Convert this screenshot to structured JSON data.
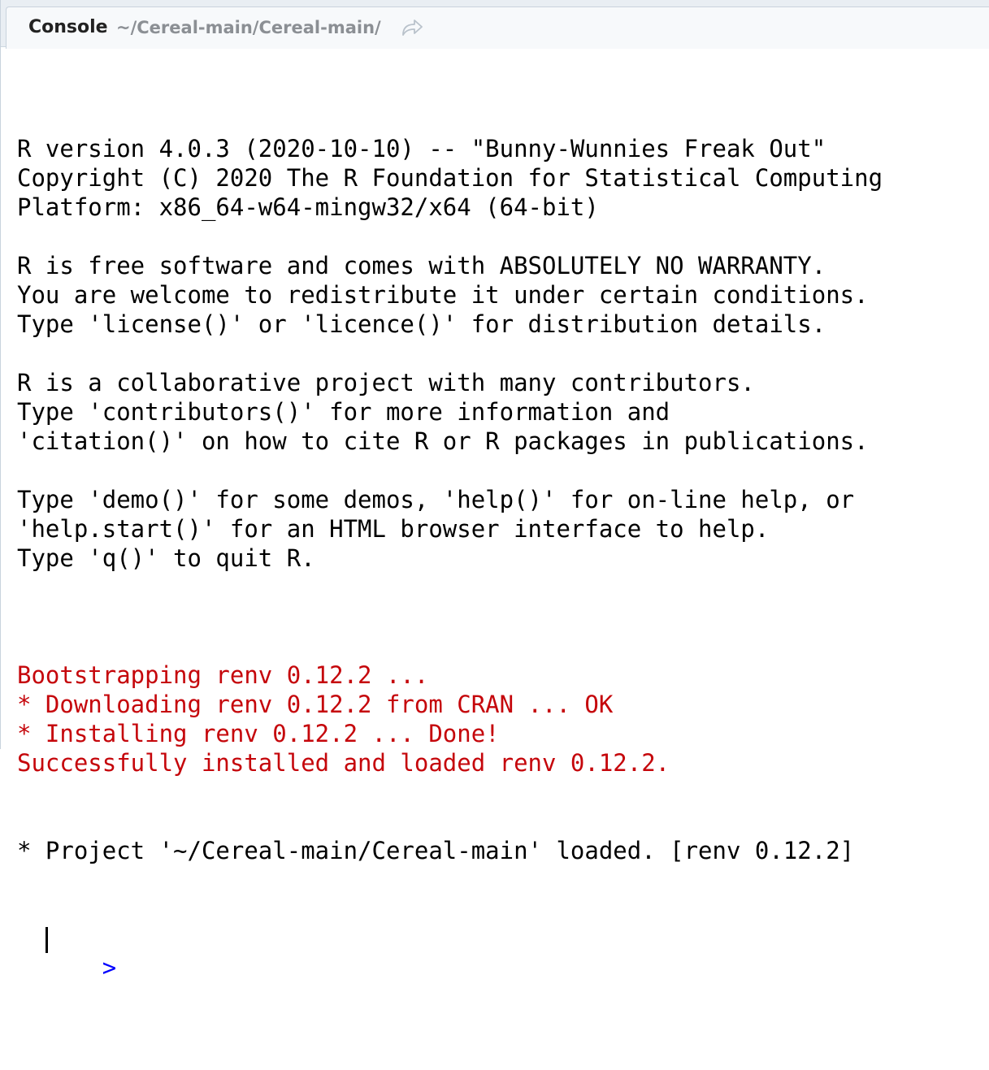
{
  "tab": {
    "title": "Console",
    "path": "~/Cereal-main/Cereal-main/",
    "goto_icon": "goto-directory-arrow-icon"
  },
  "console": {
    "startup_lines": [
      "R version 4.0.3 (2020-10-10) -- \"Bunny-Wunnies Freak Out\"",
      "Copyright (C) 2020 The R Foundation for Statistical Computing",
      "Platform: x86_64-w64-mingw32/x64 (64-bit)",
      "",
      "R is free software and comes with ABSOLUTELY NO WARRANTY.",
      "You are welcome to redistribute it under certain conditions.",
      "Type 'license()' or 'licence()' for distribution details.",
      "",
      "R is a collaborative project with many contributors.",
      "Type 'contributors()' for more information and",
      "'citation()' on how to cite R or R packages in publications.",
      "",
      "Type 'demo()' for some demos, 'help()' for on-line help, or",
      "'help.start()' for an HTML browser interface to help.",
      "Type 'q()' to quit R.",
      ""
    ],
    "message_lines": [
      "Bootstrapping renv 0.12.2 ...",
      "* Downloading renv 0.12.2 from CRAN ... OK",
      "* Installing renv 0.12.2 ... Done!",
      "Successfully installed and loaded renv 0.12.2."
    ],
    "output_lines": [
      "* Project '~/Cereal-main/Cereal-main' loaded. [renv 0.12.2]"
    ],
    "prompt": ">",
    "input_value": "",
    "colors": {
      "message": "#c5060b",
      "prompt": "#0000ff",
      "text": "#000000"
    }
  }
}
